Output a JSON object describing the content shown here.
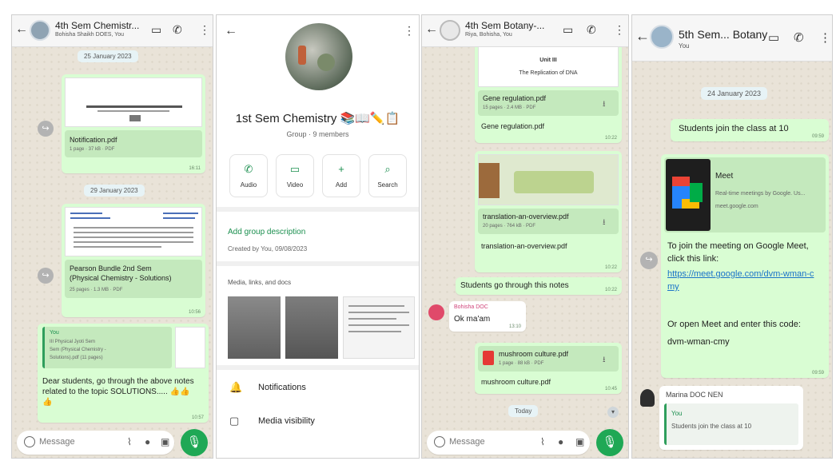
{
  "panel1": {
    "title": "4th Sem Chemistr...",
    "subtitle": "Bohisha Shaikh DOES, You",
    "date1": "25 January 2023",
    "doc1_name": "Notification.pdf",
    "doc1_meta": "1 page · 37 kB · PDF",
    "time1": "16:11",
    "date2": "29 January 2023",
    "doc2_name": "Pearson Bundle 2nd Sem",
    "doc2_name2": "(Physical Chemistry - Solutions)",
    "doc2_meta": "25 pages · 1.3 MB · PDF",
    "time2": "10:56",
    "reply_sender": "You",
    "reply_line1": "III Physical Jyoti Sem",
    "reply_line2": "Sem (Physical Chemistry -",
    "reply_line3": "Solutions).pdf (11 pages)",
    "msg_text": "Dear students, go through the above notes related to the topic SOLUTIONS..... 👍👍👍",
    "time3": "10:57",
    "composer_placeholder": "Message"
  },
  "panel2": {
    "group_name": "1st Sem Chemistry 📚📖✏️📋",
    "group_meta": "Group · 9 members",
    "actions": [
      "Audio",
      "Video",
      "Add",
      "Search"
    ],
    "add_description": "Add group description",
    "created_by": "Created by You, 09/08/2023",
    "media_label": "Media, links, and docs",
    "row1": "Notifications",
    "row2": "Media visibility"
  },
  "panel3": {
    "title": "4th Sem Botany-...",
    "subtitle": "Riya, Bohisha, You",
    "preview_heading": "Unit III",
    "preview_sub": "The Replication of DNA",
    "doc1_name": "Gene regulation.pdf",
    "doc1_meta": "15 pages · 2.4 MB · PDF",
    "doc1_caption": "Gene regulation.pdf",
    "time1": "10:22",
    "doc2_name": "translation-an-overview.pdf",
    "doc2_meta": "20 pages · 764 kB · PDF",
    "doc2_caption": "translation-an-overview.pdf",
    "time2": "10:22",
    "msg_students": "Students go through this notes",
    "time3": "10:22",
    "incoming_sender": "Bohisha DOC",
    "incoming_text": "Ok ma'am",
    "time4": "13:10",
    "doc3_name": "mushroom culture.pdf",
    "doc3_meta": "1 page · 88 kB · PDF",
    "doc3_caption": "mushroom culture.pdf",
    "time5": "10:45",
    "today_label": "Today",
    "composer_placeholder": "Message"
  },
  "panel4": {
    "title": "5th Sem... Botany",
    "subtitle": "You",
    "date": "24 January 2023",
    "msg1": "Students join the class at 10",
    "time1": "09:59",
    "link_title": "Meet",
    "link_desc": "Real-time meetings by Google. Us...",
    "link_domain": "meet.google.com",
    "msg2_line1": "To join the meeting on Google Meet,",
    "msg2_line2": "click this link:",
    "msg2_link": "https://meet.google.com/dvm-wman-cmy",
    "msg2_line3": "Or open Meet and enter this code:",
    "msg2_code": "dvm-wman-cmy",
    "time2": "09:59",
    "incoming_sender": "Marina DOC NEN",
    "quote_sender": "You",
    "quote_text": "Students join the class at 10"
  },
  "colors": {
    "outgoing_bubble": "#d9fdd3",
    "doc_card": "#c4e9bd",
    "accent_green": "#1fa855",
    "chat_bg": "#e9e3d8",
    "link_blue": "#1a73c8"
  }
}
